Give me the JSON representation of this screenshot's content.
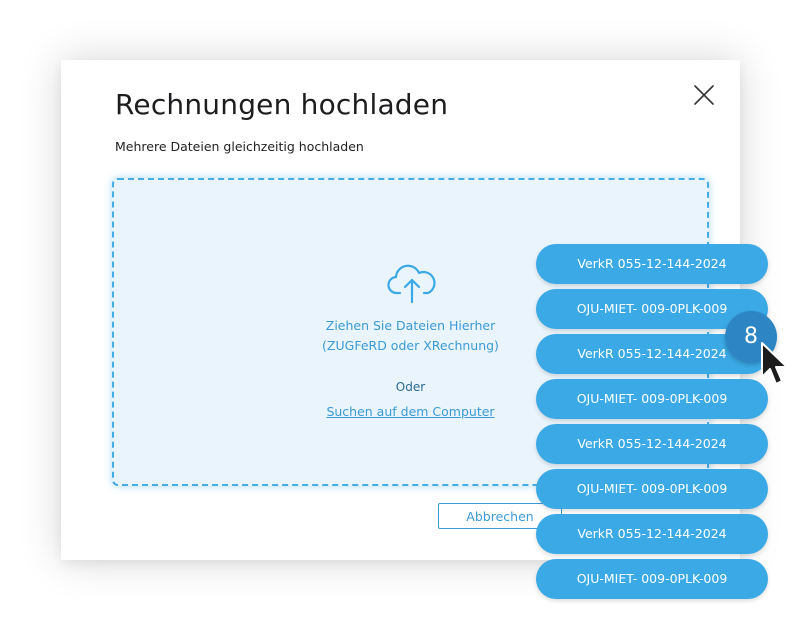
{
  "dialog": {
    "title": "Rechnungen hochladen",
    "subtitle": "Mehrere Dateien gleichzeitig hochladen",
    "close_icon": "close-icon"
  },
  "dropzone": {
    "icon": "cloud-upload-icon",
    "line1": "Ziehen Sie Dateien Hierher",
    "line2": "(ZUGFeRD oder XRechnung)",
    "or_text": "Oder",
    "browse_link": "Suchen auf dem Computer"
  },
  "footer": {
    "cancel_label": "Abbrechen"
  },
  "drag": {
    "count": "8",
    "files": [
      "VerkR 055-12-144-2024",
      "OJU-MIET- 009-0PLK-009",
      "VerkR 055-12-144-2024",
      "OJU-MIET- 009-0PLK-009",
      "VerkR 055-12-144-2024",
      "OJU-MIET- 009-0PLK-009",
      "VerkR 055-12-144-2024",
      "OJU-MIET- 009-0PLK-009"
    ],
    "cursor_icon": "mouse-pointer-icon"
  },
  "colors": {
    "accent": "#3aa9e6",
    "accent_dark": "#2d86c3",
    "dropzone_bg": "#eaf4fc",
    "dropzone_border": "#45ade5"
  }
}
